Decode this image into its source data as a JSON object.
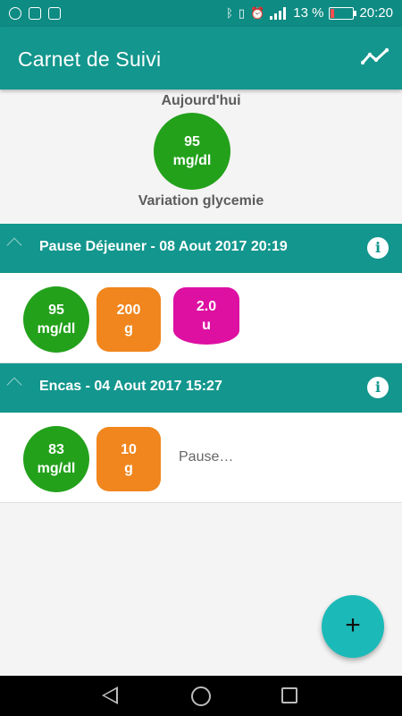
{
  "status_bar": {
    "battery_percent": "13 %",
    "time": "20:20",
    "network": "4G",
    "icons": [
      "spotify-icon",
      "cloud-icon",
      "gallery-icon",
      "bluetooth-icon",
      "vibrate-icon",
      "alarm-icon",
      "signal-icon",
      "battery-charging-icon"
    ]
  },
  "app_bar": {
    "title": "Carnet de Suivi",
    "action_icon": "trend-chart-icon"
  },
  "today": {
    "label": "Aujourd'hui",
    "glucose_value": "95",
    "glucose_unit": "mg/dl",
    "variation_label": "Variation glycemie"
  },
  "entries": [
    {
      "title": "Pause Déjeuner - 08 Aout 2017 20:19",
      "glucose_value": "95",
      "glucose_unit": "mg/dl",
      "carbs_value": "200",
      "carbs_unit": "g",
      "insulin_value": "2.0",
      "insulin_unit": "u"
    },
    {
      "title": "Encas - 04 Aout 2017 15:27",
      "glucose_value": "83",
      "glucose_unit": "mg/dl",
      "carbs_value": "10",
      "carbs_unit": "g",
      "note": "Pause…"
    }
  ],
  "fab": {
    "label": "+"
  },
  "colors": {
    "primary": "#13968d",
    "status_bar": "#0e8b83",
    "glucose": "#23a11b",
    "carbs": "#f0861d",
    "insulin": "#dd10a2",
    "fab": "#1bbab8"
  }
}
